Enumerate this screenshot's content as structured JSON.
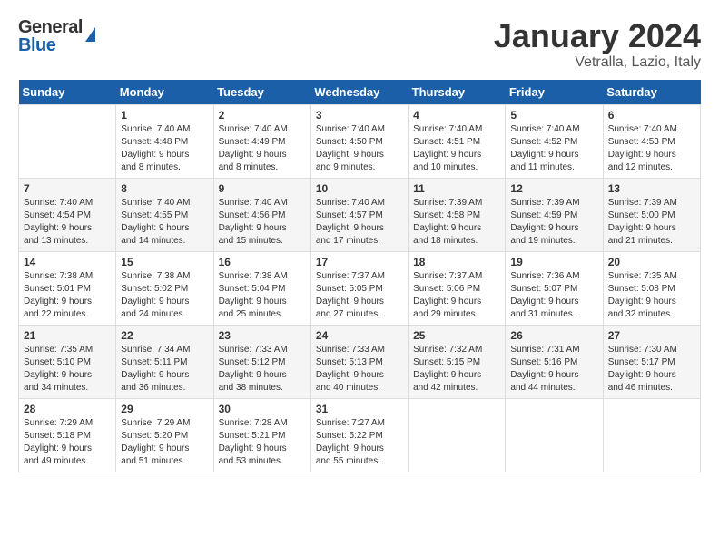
{
  "header": {
    "logo_general": "General",
    "logo_blue": "Blue",
    "month_title": "January 2024",
    "location": "Vetralla, Lazio, Italy"
  },
  "days_of_week": [
    "Sunday",
    "Monday",
    "Tuesday",
    "Wednesday",
    "Thursday",
    "Friday",
    "Saturday"
  ],
  "weeks": [
    [
      {
        "day": "",
        "info": ""
      },
      {
        "day": "1",
        "info": "Sunrise: 7:40 AM\nSunset: 4:48 PM\nDaylight: 9 hours\nand 8 minutes."
      },
      {
        "day": "2",
        "info": "Sunrise: 7:40 AM\nSunset: 4:49 PM\nDaylight: 9 hours\nand 8 minutes."
      },
      {
        "day": "3",
        "info": "Sunrise: 7:40 AM\nSunset: 4:50 PM\nDaylight: 9 hours\nand 9 minutes."
      },
      {
        "day": "4",
        "info": "Sunrise: 7:40 AM\nSunset: 4:51 PM\nDaylight: 9 hours\nand 10 minutes."
      },
      {
        "day": "5",
        "info": "Sunrise: 7:40 AM\nSunset: 4:52 PM\nDaylight: 9 hours\nand 11 minutes."
      },
      {
        "day": "6",
        "info": "Sunrise: 7:40 AM\nSunset: 4:53 PM\nDaylight: 9 hours\nand 12 minutes."
      }
    ],
    [
      {
        "day": "7",
        "info": "Sunrise: 7:40 AM\nSunset: 4:54 PM\nDaylight: 9 hours\nand 13 minutes."
      },
      {
        "day": "8",
        "info": "Sunrise: 7:40 AM\nSunset: 4:55 PM\nDaylight: 9 hours\nand 14 minutes."
      },
      {
        "day": "9",
        "info": "Sunrise: 7:40 AM\nSunset: 4:56 PM\nDaylight: 9 hours\nand 15 minutes."
      },
      {
        "day": "10",
        "info": "Sunrise: 7:40 AM\nSunset: 4:57 PM\nDaylight: 9 hours\nand 17 minutes."
      },
      {
        "day": "11",
        "info": "Sunrise: 7:39 AM\nSunset: 4:58 PM\nDaylight: 9 hours\nand 18 minutes."
      },
      {
        "day": "12",
        "info": "Sunrise: 7:39 AM\nSunset: 4:59 PM\nDaylight: 9 hours\nand 19 minutes."
      },
      {
        "day": "13",
        "info": "Sunrise: 7:39 AM\nSunset: 5:00 PM\nDaylight: 9 hours\nand 21 minutes."
      }
    ],
    [
      {
        "day": "14",
        "info": "Sunrise: 7:38 AM\nSunset: 5:01 PM\nDaylight: 9 hours\nand 22 minutes."
      },
      {
        "day": "15",
        "info": "Sunrise: 7:38 AM\nSunset: 5:02 PM\nDaylight: 9 hours\nand 24 minutes."
      },
      {
        "day": "16",
        "info": "Sunrise: 7:38 AM\nSunset: 5:04 PM\nDaylight: 9 hours\nand 25 minutes."
      },
      {
        "day": "17",
        "info": "Sunrise: 7:37 AM\nSunset: 5:05 PM\nDaylight: 9 hours\nand 27 minutes."
      },
      {
        "day": "18",
        "info": "Sunrise: 7:37 AM\nSunset: 5:06 PM\nDaylight: 9 hours\nand 29 minutes."
      },
      {
        "day": "19",
        "info": "Sunrise: 7:36 AM\nSunset: 5:07 PM\nDaylight: 9 hours\nand 31 minutes."
      },
      {
        "day": "20",
        "info": "Sunrise: 7:35 AM\nSunset: 5:08 PM\nDaylight: 9 hours\nand 32 minutes."
      }
    ],
    [
      {
        "day": "21",
        "info": "Sunrise: 7:35 AM\nSunset: 5:10 PM\nDaylight: 9 hours\nand 34 minutes."
      },
      {
        "day": "22",
        "info": "Sunrise: 7:34 AM\nSunset: 5:11 PM\nDaylight: 9 hours\nand 36 minutes."
      },
      {
        "day": "23",
        "info": "Sunrise: 7:33 AM\nSunset: 5:12 PM\nDaylight: 9 hours\nand 38 minutes."
      },
      {
        "day": "24",
        "info": "Sunrise: 7:33 AM\nSunset: 5:13 PM\nDaylight: 9 hours\nand 40 minutes."
      },
      {
        "day": "25",
        "info": "Sunrise: 7:32 AM\nSunset: 5:15 PM\nDaylight: 9 hours\nand 42 minutes."
      },
      {
        "day": "26",
        "info": "Sunrise: 7:31 AM\nSunset: 5:16 PM\nDaylight: 9 hours\nand 44 minutes."
      },
      {
        "day": "27",
        "info": "Sunrise: 7:30 AM\nSunset: 5:17 PM\nDaylight: 9 hours\nand 46 minutes."
      }
    ],
    [
      {
        "day": "28",
        "info": "Sunrise: 7:29 AM\nSunset: 5:18 PM\nDaylight: 9 hours\nand 49 minutes."
      },
      {
        "day": "29",
        "info": "Sunrise: 7:29 AM\nSunset: 5:20 PM\nDaylight: 9 hours\nand 51 minutes."
      },
      {
        "day": "30",
        "info": "Sunrise: 7:28 AM\nSunset: 5:21 PM\nDaylight: 9 hours\nand 53 minutes."
      },
      {
        "day": "31",
        "info": "Sunrise: 7:27 AM\nSunset: 5:22 PM\nDaylight: 9 hours\nand 55 minutes."
      },
      {
        "day": "",
        "info": ""
      },
      {
        "day": "",
        "info": ""
      },
      {
        "day": "",
        "info": ""
      }
    ]
  ]
}
